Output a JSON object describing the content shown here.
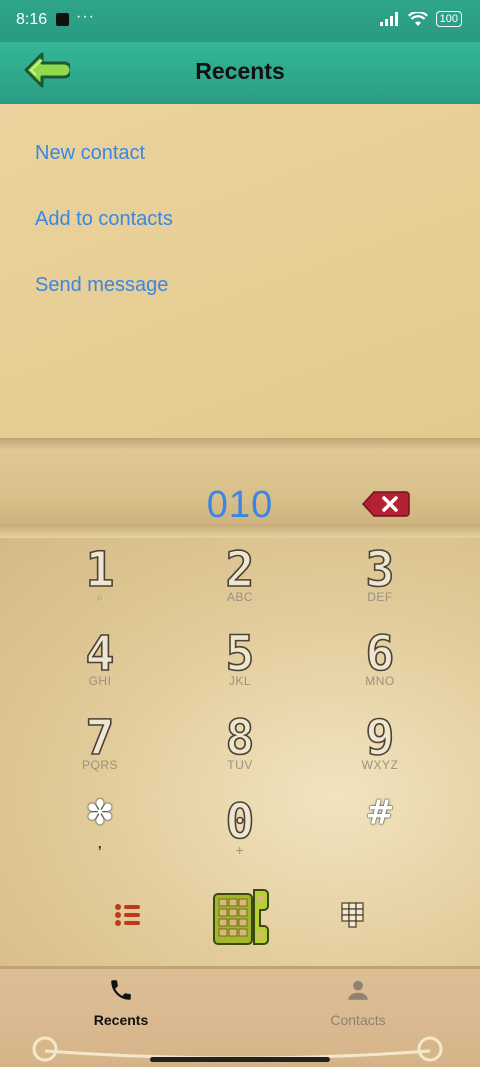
{
  "status_bar": {
    "time": "8:16",
    "dots": "···",
    "battery": "100"
  },
  "header": {
    "title": "Recents"
  },
  "actions": [
    {
      "label": "New contact"
    },
    {
      "label": "Add to contacts"
    },
    {
      "label": "Send message"
    }
  ],
  "dialer": {
    "number": "010",
    "keys": [
      {
        "digit": "1",
        "letters": "⌕"
      },
      {
        "digit": "2",
        "letters": "ABC"
      },
      {
        "digit": "3",
        "letters": "DEF"
      },
      {
        "digit": "4",
        "letters": "GHI"
      },
      {
        "digit": "5",
        "letters": "JKL"
      },
      {
        "digit": "6",
        "letters": "MNO"
      },
      {
        "digit": "7",
        "letters": "PQRS"
      },
      {
        "digit": "8",
        "letters": "TUV"
      },
      {
        "digit": "9",
        "letters": "WXYZ"
      },
      {
        "digit": "*",
        "letters": ","
      },
      {
        "digit": "0",
        "letters": "+"
      },
      {
        "digit": "#",
        "letters": ""
      }
    ]
  },
  "bottom_nav": {
    "recents_label": "Recents",
    "contacts_label": "Contacts"
  },
  "colors": {
    "accent": "#3a86e4",
    "header": "#2fa58c",
    "backspace": "#b22232"
  }
}
